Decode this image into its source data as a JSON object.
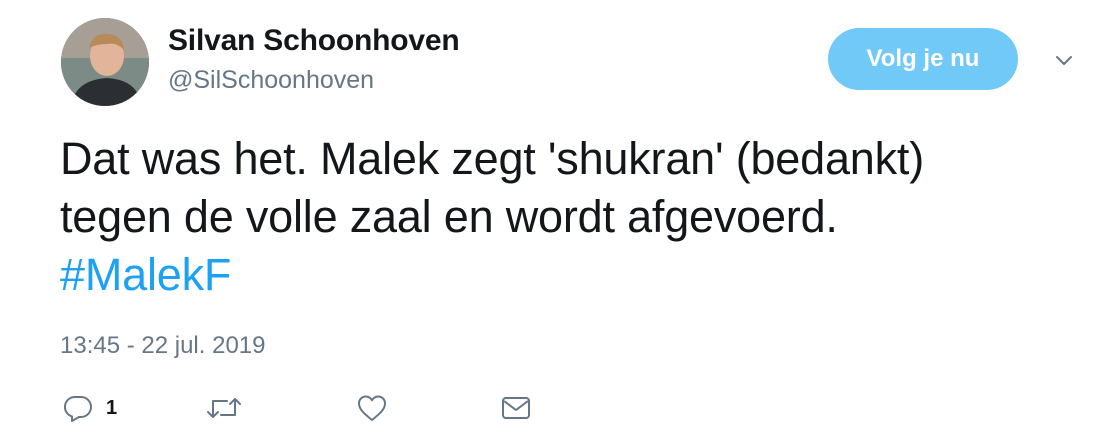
{
  "user": {
    "display_name": "Silvan Schoonhoven",
    "handle": "@SilSchoonhoven"
  },
  "follow_button": {
    "label": "Volg je nu"
  },
  "tweet": {
    "text_line1": "Dat was het. Malek zegt 'shukran' (bedankt)",
    "text_line2": "tegen de volle zaal en wordt afgevoerd.",
    "hashtag": "#MalekF",
    "timestamp": "13:45 - 22 jul. 2019"
  },
  "actions": {
    "reply_count": "1"
  },
  "icons": {
    "menu": "chevron-down-icon",
    "reply": "reply-icon",
    "retweet": "retweet-icon",
    "like": "heart-icon",
    "dm": "envelope-icon"
  },
  "colors": {
    "link": "#1da1f2",
    "follow_button": "#71c9f8",
    "secondary_text": "#657786",
    "icon": "#657786"
  }
}
